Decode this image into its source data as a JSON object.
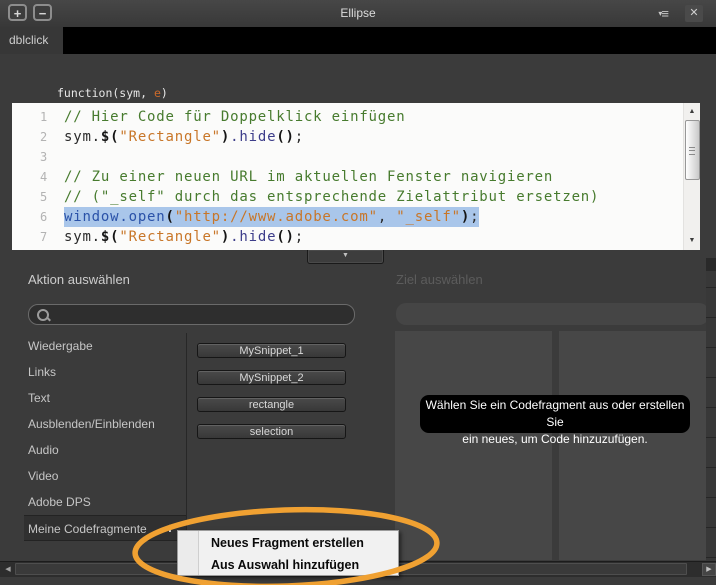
{
  "titlebar": {
    "title": "Ellipse",
    "zoom_in": "+",
    "zoom_out": "−",
    "panel_menu_icon": "≡",
    "close_icon": "✕"
  },
  "tab": {
    "label": "dblclick"
  },
  "editor": {
    "signature": {
      "prefix": "function(sym, ",
      "param": "e",
      "suffix": ")"
    },
    "lines": [
      {
        "num": "1",
        "tokens": [
          {
            "c": "comment",
            "t": "// Hier Code für Doppelklick einfügen"
          }
        ]
      },
      {
        "num": "2",
        "tokens": [
          {
            "c": "plain",
            "t": "sym."
          },
          {
            "c": "bracket",
            "t": "$("
          },
          {
            "c": "string",
            "t": "\"Rectangle\""
          },
          {
            "c": "bracket",
            "t": ")"
          },
          {
            "c": "method",
            "t": ".hide"
          },
          {
            "c": "bracket",
            "t": "()"
          },
          {
            "c": "plain",
            "t": ";"
          }
        ]
      },
      {
        "num": "3",
        "tokens": []
      },
      {
        "num": "4",
        "tokens": [
          {
            "c": "comment",
            "t": "// Zu einer neuen URL im aktuellen Fenster navigieren"
          }
        ]
      },
      {
        "num": "5",
        "tokens": [
          {
            "c": "comment",
            "t": "// (\"_self\" durch das entsprechende Zielattribut ersetzen)"
          }
        ]
      },
      {
        "num": "6",
        "selected": true,
        "tokens": [
          {
            "c": "keyword",
            "t": "window.open"
          },
          {
            "c": "bracket",
            "t": "("
          },
          {
            "c": "string",
            "t": "\"http://www.adobe.com\""
          },
          {
            "c": "plain",
            "t": ", "
          },
          {
            "c": "string",
            "t": "\"_self\""
          },
          {
            "c": "bracket",
            "t": ")"
          },
          {
            "c": "plain",
            "t": ";"
          }
        ]
      },
      {
        "num": "7",
        "tokens": [
          {
            "c": "plain",
            "t": "sym."
          },
          {
            "c": "bracket",
            "t": "$("
          },
          {
            "c": "string",
            "t": "\"Rectangle\""
          },
          {
            "c": "bracket",
            "t": ")"
          },
          {
            "c": "method",
            "t": ".hide"
          },
          {
            "c": "bracket",
            "t": "()"
          },
          {
            "c": "plain",
            "t": ";"
          }
        ]
      }
    ]
  },
  "actions": {
    "heading": "Aktion auswählen",
    "categories": [
      "Wiedergabe",
      "Links",
      "Text",
      "Ausblenden/Einblenden",
      "Audio",
      "Video",
      "Adobe DPS",
      "Meine Codefragmente"
    ],
    "selected_category": "Meine Codefragmente",
    "add_icon": "+"
  },
  "snippets": [
    "MySnippet_1",
    "MySnippet_2",
    "rectangle",
    "selection"
  ],
  "target": {
    "heading": "Ziel auswählen",
    "tooltip_line1": "Wählen Sie ein Codefragment aus oder erstellen Sie",
    "tooltip_line2": "ein neues, um Code hinzuzufügen."
  },
  "context_menu": {
    "items": [
      "Neues Fragment erstellen",
      "Aus Auswahl hinzufügen"
    ]
  },
  "icons": {
    "collapse": "▼",
    "scroll_up": "▲",
    "scroll_down": "▼",
    "scroll_left": "◀",
    "scroll_right": "▶",
    "menu_caret": "▾"
  },
  "colors": {
    "annotation_orange": "#F0A132",
    "selection_blue": "#A9C6EA",
    "comment_green": "#477B2E",
    "string_orange": "#C87628",
    "keyword_blue": "#2A52A8",
    "tooltip_bg": "#000000"
  }
}
